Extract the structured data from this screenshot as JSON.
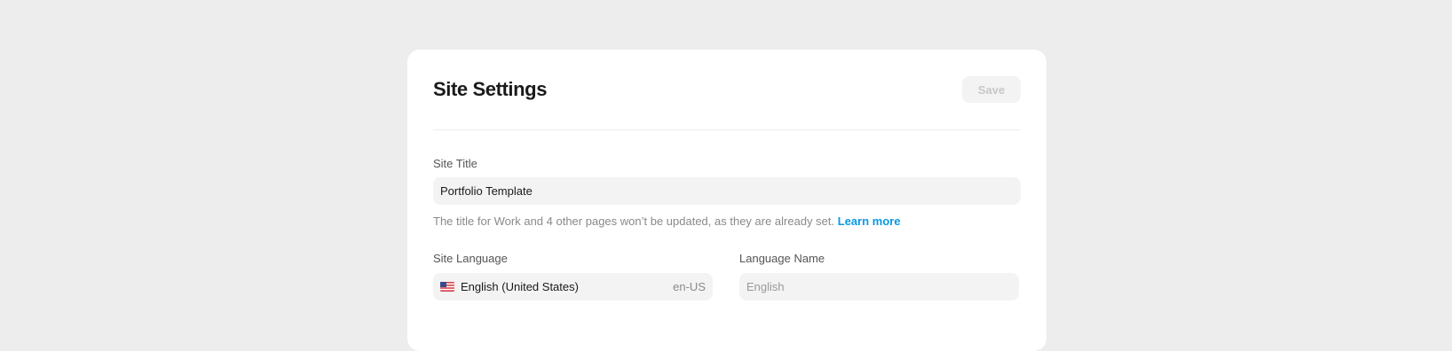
{
  "settings": {
    "title": "Site Settings",
    "save_label": "Save",
    "site_title": {
      "label": "Site Title",
      "value": "Portfolio Template"
    },
    "helper": {
      "text": "The title for Work and 4 other pages won’t be updated, as they are already set.",
      "link": "Learn more"
    },
    "site_language": {
      "label": "Site Language",
      "value": "English (United States)",
      "code": "en-US",
      "flag_icon": "us-flag-icon"
    },
    "language_name": {
      "label": "Language Name",
      "placeholder": "English"
    }
  },
  "colors": {
    "background": "#ededed",
    "card": "#ffffff",
    "field": "#f3f3f3",
    "link": "#0a99e6",
    "save_disabled_text": "#c8c8c8"
  }
}
